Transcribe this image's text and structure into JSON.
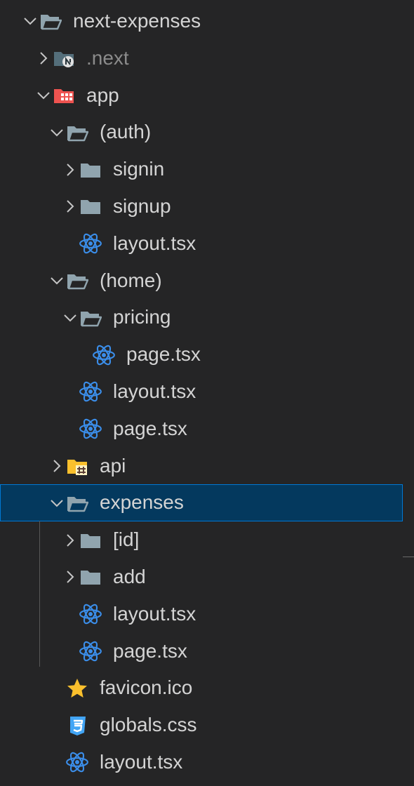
{
  "explorer": {
    "items": [
      {
        "label": "next-expenses",
        "kind": "folder",
        "icon": "folder-open-icon",
        "depth": 0,
        "expanded": true
      },
      {
        "label": ".next",
        "kind": "folder",
        "icon": "nextjs-folder-icon",
        "depth": 1,
        "expanded": false,
        "dim": true
      },
      {
        "label": "app",
        "kind": "folder",
        "icon": "app-folder-icon",
        "depth": 1,
        "expanded": true
      },
      {
        "label": "(auth)",
        "kind": "folder",
        "icon": "folder-open-icon",
        "depth": 2,
        "expanded": true
      },
      {
        "label": "signin",
        "kind": "folder",
        "icon": "folder-icon",
        "depth": 3,
        "expanded": false
      },
      {
        "label": "signup",
        "kind": "folder",
        "icon": "folder-icon",
        "depth": 3,
        "expanded": false
      },
      {
        "label": "layout.tsx",
        "kind": "file",
        "icon": "react-icon",
        "depth": 3
      },
      {
        "label": "(home)",
        "kind": "folder",
        "icon": "folder-open-icon",
        "depth": 2,
        "expanded": true
      },
      {
        "label": "pricing",
        "kind": "folder",
        "icon": "folder-open-icon",
        "depth": 3,
        "expanded": true
      },
      {
        "label": "page.tsx",
        "kind": "file",
        "icon": "react-icon",
        "depth": 4
      },
      {
        "label": "layout.tsx",
        "kind": "file",
        "icon": "react-icon",
        "depth": 3
      },
      {
        "label": "page.tsx",
        "kind": "file",
        "icon": "react-icon",
        "depth": 3
      },
      {
        "label": "api",
        "kind": "folder",
        "icon": "api-folder-icon",
        "depth": 2,
        "expanded": false
      },
      {
        "label": "expenses",
        "kind": "folder",
        "icon": "folder-open-icon",
        "depth": 2,
        "expanded": true,
        "selected": true
      },
      {
        "label": "[id]",
        "kind": "folder",
        "icon": "folder-icon",
        "depth": 3,
        "expanded": false
      },
      {
        "label": "add",
        "kind": "folder",
        "icon": "folder-icon",
        "depth": 3,
        "expanded": false
      },
      {
        "label": "layout.tsx",
        "kind": "file",
        "icon": "react-icon",
        "depth": 3
      },
      {
        "label": "page.tsx",
        "kind": "file",
        "icon": "react-icon",
        "depth": 3
      },
      {
        "label": "favicon.ico",
        "kind": "file",
        "icon": "star-icon",
        "depth": 2
      },
      {
        "label": "globals.css",
        "kind": "file",
        "icon": "css-icon",
        "depth": 2
      },
      {
        "label": "layout.tsx",
        "kind": "file",
        "icon": "react-icon",
        "depth": 2
      }
    ]
  },
  "colors": {
    "background": "#252526",
    "text": "#d4d4d4",
    "dim_text": "#8b8b8b",
    "folder": "#90a4ae",
    "react": "#3b8eea",
    "css": "#42a5f5",
    "star": "#fbc02d",
    "api_folder": "#fbc02d",
    "app_folder": "#ef5350",
    "selection_bg": "#04395e",
    "selection_border": "#0078d4",
    "indent_guide": "#585858"
  }
}
